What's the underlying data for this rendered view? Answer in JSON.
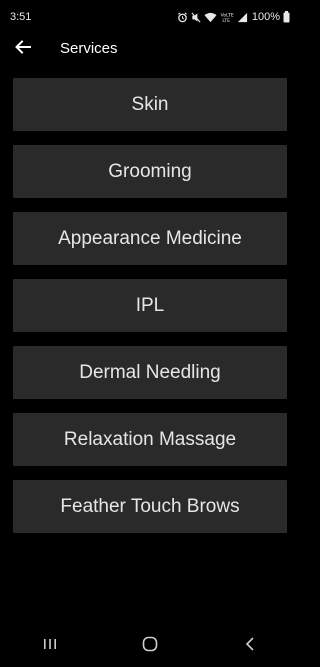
{
  "status_bar": {
    "time": "3:51",
    "battery": "100%",
    "icons": [
      "alarm-icon",
      "mute-icon",
      "wifi-icon",
      "volte-icon",
      "signal-icon",
      "battery-icon"
    ]
  },
  "app_bar": {
    "back_icon": "arrow-left-icon",
    "title": "Services"
  },
  "services": [
    {
      "label": "Skin"
    },
    {
      "label": "Grooming"
    },
    {
      "label": "Appearance Medicine"
    },
    {
      "label": "IPL"
    },
    {
      "label": "Dermal Needling"
    },
    {
      "label": "Relaxation Massage"
    },
    {
      "label": "Feather Touch Brows"
    }
  ],
  "nav_bar": {
    "icons": [
      "recent-apps-icon",
      "home-icon",
      "back-icon"
    ]
  },
  "colors": {
    "background": "#000000",
    "button": "#2a2a2a",
    "text": "#e6e6e6"
  }
}
